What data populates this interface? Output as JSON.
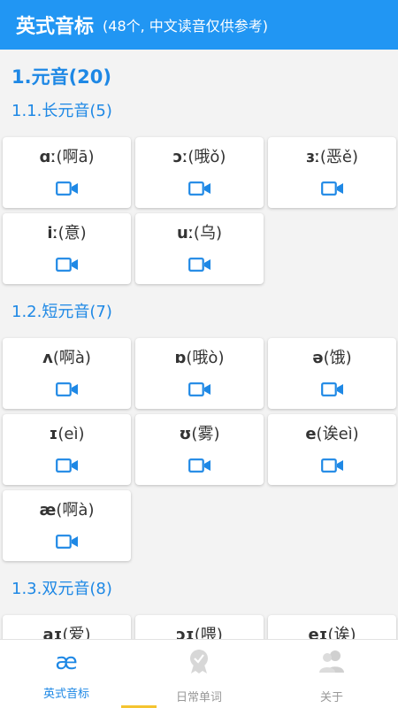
{
  "appbar": {
    "title": "英式音标",
    "subtitle": "(48个, 中文读音仅供参考)"
  },
  "sections": [
    {
      "title": "1.元音(20)",
      "groups": [
        {
          "title": "1.1.长元音(5)",
          "items": [
            {
              "sym": "ɑː",
              "hint": "(啊ā)"
            },
            {
              "sym": "ɔː",
              "hint": "(哦ǒ)"
            },
            {
              "sym": "ɜː",
              "hint": "(恶ě)"
            },
            {
              "sym": "iː",
              "hint": "(意)"
            },
            {
              "sym": "uː",
              "hint": "(乌)"
            }
          ]
        },
        {
          "title": "1.2.短元音(7)",
          "items": [
            {
              "sym": "ʌ",
              "hint": "(啊à)"
            },
            {
              "sym": "ɒ",
              "hint": "(哦ò)"
            },
            {
              "sym": "ə",
              "hint": "(饿)"
            },
            {
              "sym": "ɪ",
              "hint": "(eì)"
            },
            {
              "sym": "ʊ",
              "hint": "(雾)"
            },
            {
              "sym": "e",
              "hint": "(诶eì)"
            },
            {
              "sym": "æ",
              "hint": "(啊à)"
            }
          ]
        },
        {
          "title": "1.3.双元音(8)",
          "items": [
            {
              "sym": "aɪ",
              "hint": "(爱)"
            },
            {
              "sym": "ɔɪ",
              "hint": "(喂)"
            },
            {
              "sym": "eɪ",
              "hint": "(诶)"
            }
          ]
        }
      ]
    }
  ],
  "tabs": [
    {
      "label": "英式音标",
      "icon": "ae-icon"
    },
    {
      "label": "日常单词",
      "icon": "badge-icon"
    },
    {
      "label": "关于",
      "icon": "people-icon"
    }
  ],
  "colors": {
    "primary": "#2196f3",
    "accent": "#f4c430"
  }
}
